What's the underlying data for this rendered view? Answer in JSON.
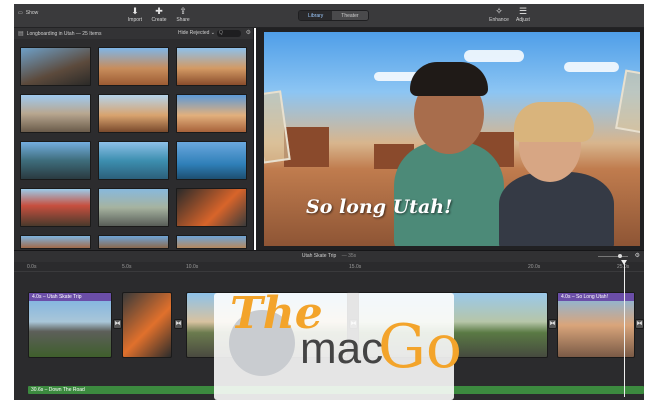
{
  "toolbar": {
    "show_label": "Show",
    "import_label": "Import",
    "create_label": "Create",
    "share_label": "Share",
    "library_tab": "Library",
    "theater_tab": "Theater",
    "enhance_label": "Enhance",
    "adjust_label": "Adjust"
  },
  "browser": {
    "event_title": "Longboarding in Utah — 25 Items",
    "hide_rejected": "Hide Rejected",
    "hide_rejected_arrow": "⌄",
    "search_placeholder": "Q"
  },
  "viewer": {
    "title_overlay": "So long Utah!"
  },
  "timeline": {
    "project_title": "Utah Skate Trip",
    "project_duration": "— 35s",
    "ruler": [
      "0.0s",
      "5.0s",
      "10.0s",
      "15.0s",
      "20.0s",
      "25.0s"
    ],
    "clips": [
      {
        "title": "4.0s – Utah Skate Trip"
      },
      {
        "title": ""
      },
      {
        "title": ""
      },
      {
        "title": ""
      },
      {
        "title": "4.0s – So Long Utah!"
      }
    ],
    "audio_label": "30.6s – Down The Road"
  },
  "watermark": {
    "the": "The",
    "mac": "mac",
    "go": "Go"
  },
  "colors": {
    "title_clip": "#6b4ea8",
    "audio_clip": "#3c8a3f",
    "accent": "#9ecbff",
    "watermark_orange": "#f3a42b"
  }
}
